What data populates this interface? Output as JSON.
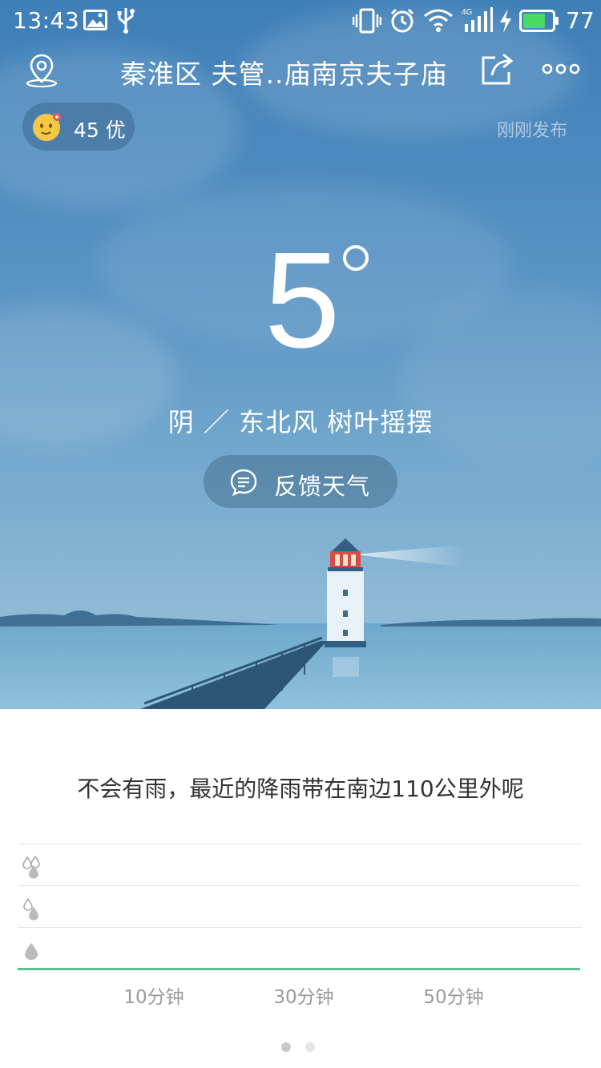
{
  "status_bar": {
    "time": "13:43",
    "battery_text": "77",
    "battery_level": 0.77,
    "network_label": "4G",
    "icons": [
      "image-icon",
      "usb-icon",
      "vibrate-icon",
      "alarm-icon",
      "wifi-icon",
      "signal-icon",
      "charging-icon",
      "battery-icon"
    ]
  },
  "header": {
    "location": "秦淮区 夫管..庙南京夫子庙",
    "icons": [
      "location-pin-icon",
      "share-icon",
      "more-icon"
    ]
  },
  "aqi": {
    "label": "45 优",
    "icon": "smiley-face-icon"
  },
  "updated_text": "刚刚发布",
  "weather": {
    "temperature": "5",
    "condition": "阴 ／ 东北风 树叶摇摆"
  },
  "feedback_button": {
    "label": "反馈天气",
    "icon": "chat-bubble-icon"
  },
  "precipitation": {
    "message": "不会有雨，最近的降雨带在南边110公里外呢",
    "levels": [
      "heavy-rain-icon",
      "moderate-rain-icon",
      "light-rain-icon"
    ],
    "x_ticks": [
      "10分钟",
      "30分钟",
      "50分钟"
    ],
    "baseline_color": "#5cc08a"
  },
  "pager": {
    "count": 2,
    "active": 0
  }
}
